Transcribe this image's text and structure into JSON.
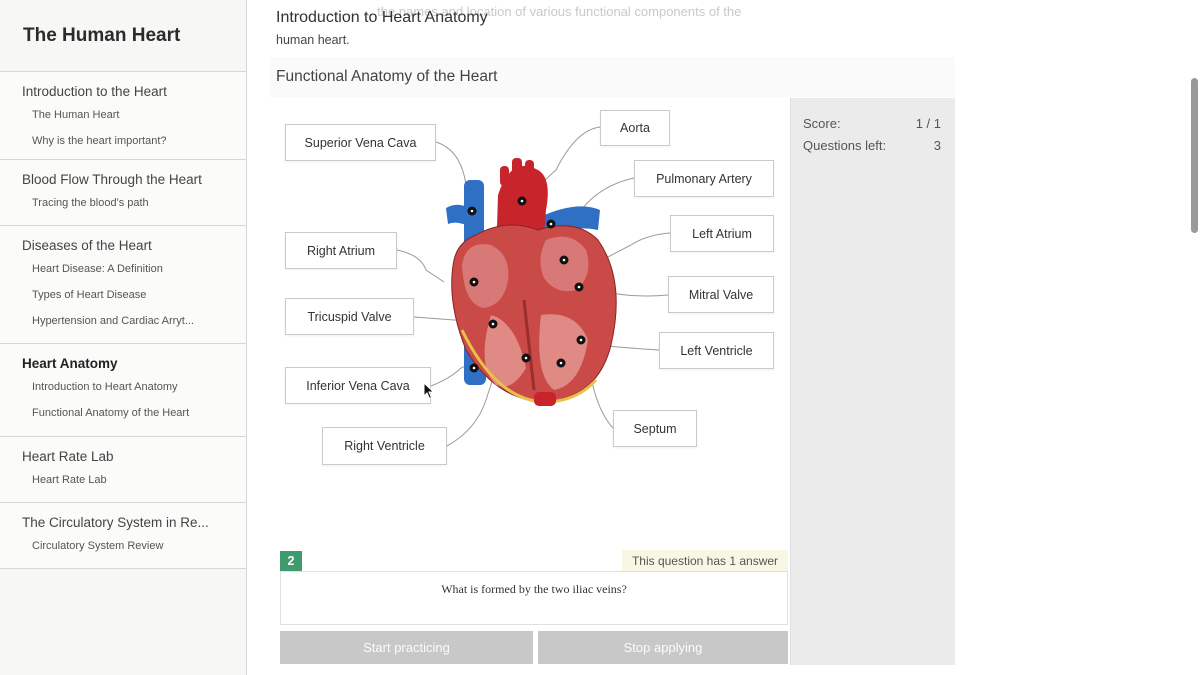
{
  "sidebar": {
    "title": "The Human Heart",
    "sections": [
      {
        "title": "Introduction to the Heart",
        "items": [
          "The Human Heart",
          "Why is the heart important?"
        ]
      },
      {
        "title": "Blood Flow Through the Heart",
        "items": [
          "Tracing the blood's path"
        ]
      },
      {
        "title": "Diseases of the Heart",
        "items": [
          "Heart Disease: A Definition",
          "Types of Heart Disease",
          "Hypertension and Cardiac Arryt..."
        ]
      },
      {
        "title": "Heart Anatomy",
        "items": [
          "Introduction to Heart Anatomy",
          "Functional Anatomy of the Heart"
        ]
      },
      {
        "title": "Heart Rate Lab",
        "items": [
          "Heart Rate Lab"
        ]
      },
      {
        "title": "The Circulatory System in Re...",
        "items": [
          "Circulatory System Review"
        ]
      }
    ]
  },
  "main": {
    "faded_text": "...  ...  ...  ...  ...  ...  ...  the names and location of various functional components of the",
    "title": "Introduction to Heart Anatomy",
    "subtitle": "human heart.",
    "panel_title": "Functional Anatomy of the Heart"
  },
  "labels": {
    "superior_vena_cava": "Superior Vena Cava",
    "aorta": "Aorta",
    "pulmonary_artery": "Pulmonary Artery",
    "left_atrium": "Left Atrium",
    "right_atrium": "Right Atrium",
    "mitral_valve": "Mitral Valve",
    "tricuspid_valve": "Tricuspid Valve",
    "left_ventricle": "Left Ventricle",
    "inferior_vena_cava": "Inferior Vena Cava",
    "septum": "Septum",
    "right_ventricle": "Right Ventricle"
  },
  "score": {
    "score_label": "Score:",
    "score_value": "1 / 1",
    "questions_left_label": "Questions left:",
    "questions_left_value": "3"
  },
  "question": {
    "number": "2",
    "answer_note": "This question has 1 answer",
    "text": "What is formed by the two iliac veins?",
    "start_button": "Start practicing",
    "stop_button": "Stop applying"
  },
  "colors": {
    "accent_green": "#3f9a6d",
    "artery_red": "#c8242c",
    "vein_blue": "#2f6fc4",
    "button_gray": "#c8c8c8"
  }
}
